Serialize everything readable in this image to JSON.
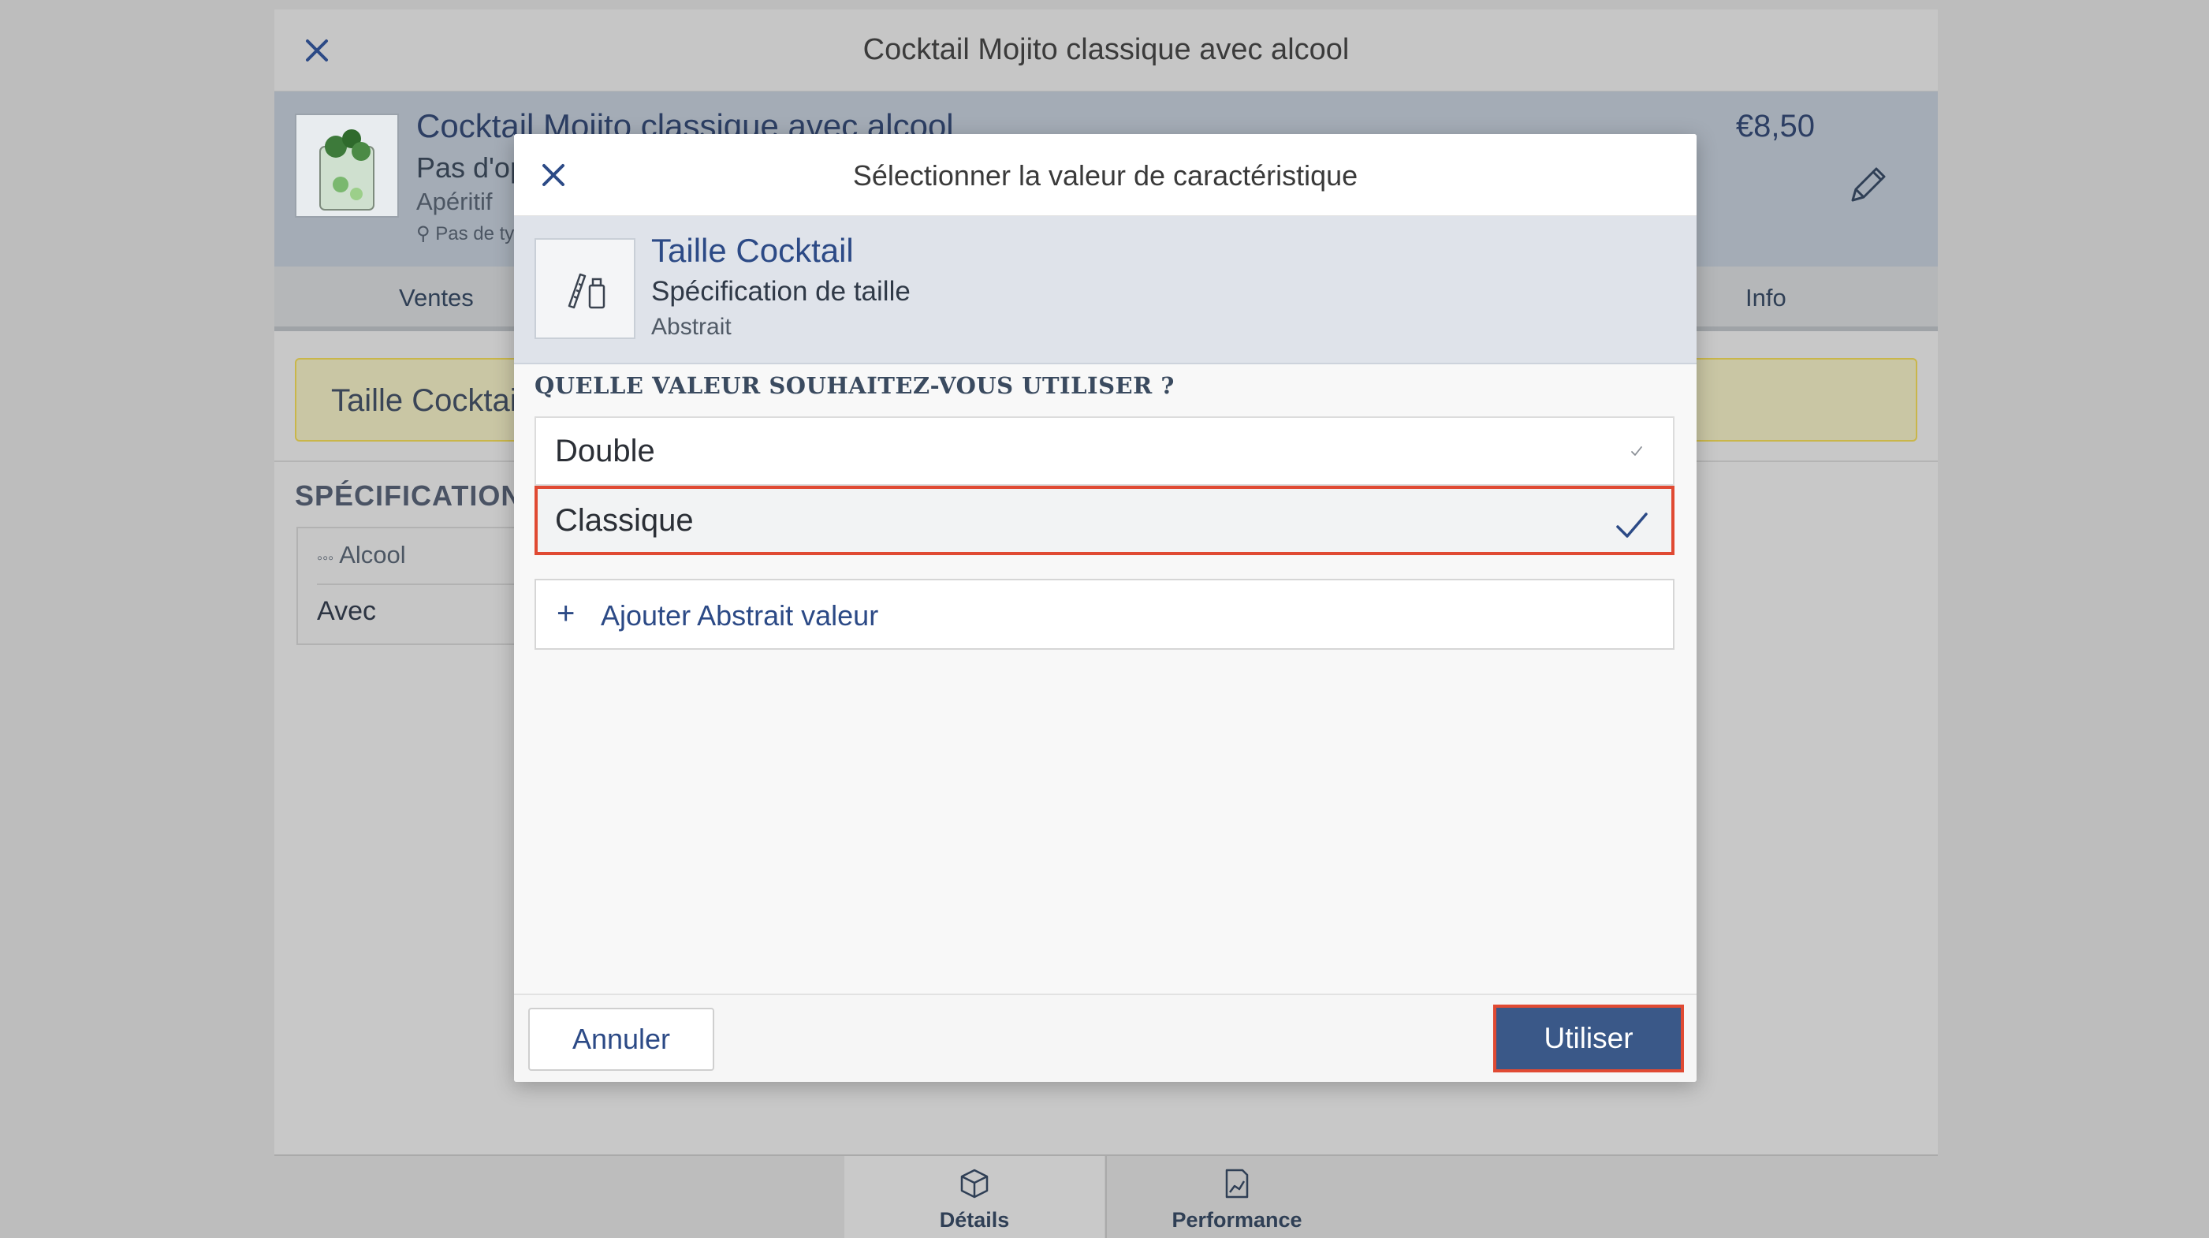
{
  "app": {
    "title": "Cocktail Mojito classique avec alcool",
    "product": {
      "name": "Cocktail Mojito classique avec alcool",
      "line1": "Pas d'op",
      "line2": "Apéritif",
      "line3": "Pas de ty",
      "price": "€8,50"
    },
    "tabs": [
      "Ventes",
      "Info"
    ],
    "banner": "Taille Cocktai",
    "specifications": {
      "title": "SPÉCIFICATIONS",
      "card_label": "Alcool",
      "card_value": "Avec"
    },
    "bottom_nav": [
      {
        "label": "Détails",
        "icon": "box-icon",
        "active": true
      },
      {
        "label": "Performance",
        "icon": "chart-icon",
        "active": false
      }
    ]
  },
  "modal": {
    "title": "Sélectionner la valeur de caractéristique",
    "characteristic": {
      "name": "Taille Cocktail",
      "type": "Spécification de taille",
      "kind": "Abstrait",
      "icon": "size-spec-icon"
    },
    "question": "QUELLE VALEUR SOUHAITEZ-VOUS UTILISER ?",
    "options": [
      {
        "label": "Double",
        "selected": false
      },
      {
        "label": "Classique",
        "selected": true
      }
    ],
    "add_label": "Ajouter Abstrait valeur",
    "cancel_label": "Annuler",
    "use_label": "Utiliser"
  },
  "colors": {
    "accent": "#2c4a86",
    "primary_button": "#3a5888",
    "highlight_border": "#e04a33",
    "banner_border": "#c9b64a"
  }
}
